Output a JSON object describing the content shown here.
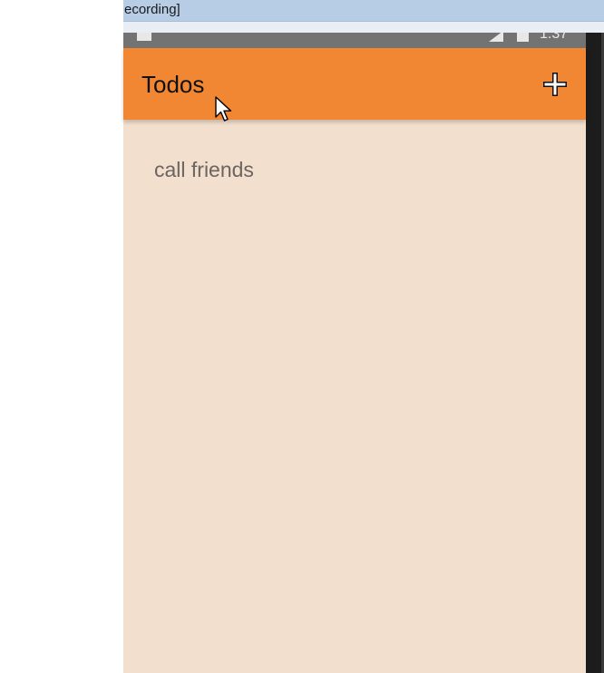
{
  "recording": {
    "title": "ecording]"
  },
  "status_bar": {
    "time": "1:37"
  },
  "app_bar": {
    "title": "Todos",
    "add_icon": "plus-icon"
  },
  "todos": [
    {
      "label": "call friends"
    }
  ],
  "colors": {
    "app_bar": "#f28733",
    "content_bg": "#f3dfcd",
    "todo_text": "#6b6461",
    "status_bar": "#737373"
  }
}
